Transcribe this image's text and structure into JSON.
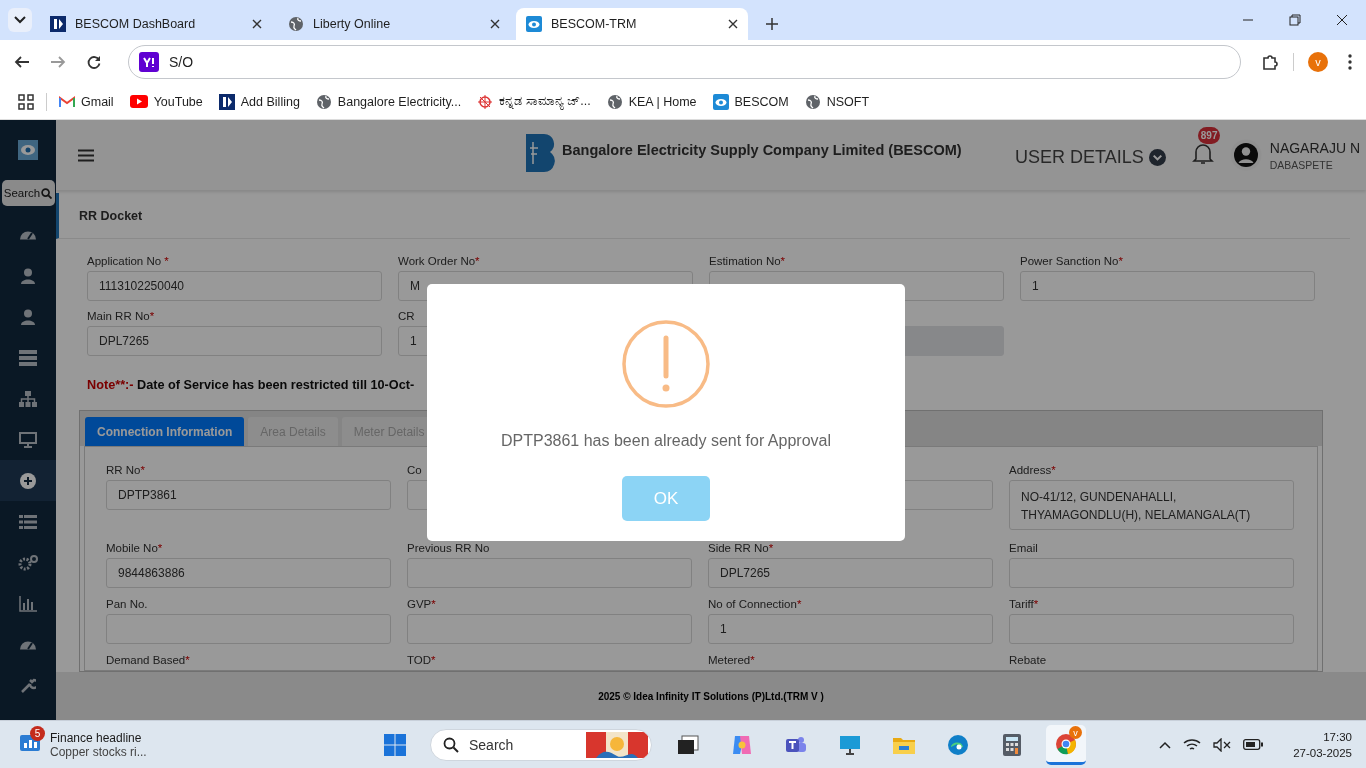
{
  "browser": {
    "tabs": [
      {
        "title": "BESCOM DashBoard",
        "kind": "bescom",
        "selected": false
      },
      {
        "title": "Liberty Online",
        "kind": "globe",
        "selected": false
      },
      {
        "title": "BESCOM-TRM",
        "kind": "trm",
        "selected": true
      }
    ],
    "address": "S/O",
    "profile": "v",
    "bookmarks": [
      {
        "label": "Gmail",
        "kind": "gmail"
      },
      {
        "label": "YouTube",
        "kind": "youtube"
      },
      {
        "label": "Add Billing",
        "kind": "bescom"
      },
      {
        "label": "Bangalore Electricity...",
        "kind": "globe"
      },
      {
        "label": "ಕನ್ನಡ ಸಾಮಾನ್ಯ ಜ್...",
        "kind": "emblem"
      },
      {
        "label": "KEA | Home",
        "kind": "globe"
      },
      {
        "label": "BESCOM",
        "kind": "trm"
      },
      {
        "label": "NSOFT",
        "kind": "globe"
      }
    ]
  },
  "sidebar": {
    "search": "Search",
    "items": [
      {
        "kind": "gauge",
        "selected": false
      },
      {
        "kind": "user",
        "selected": false
      },
      {
        "kind": "user",
        "selected": false
      },
      {
        "kind": "server",
        "selected": false
      },
      {
        "kind": "sitemap",
        "selected": false
      },
      {
        "kind": "desktop",
        "selected": false
      },
      {
        "kind": "plus",
        "selected": true
      },
      {
        "kind": "list",
        "selected": false
      },
      {
        "kind": "cogs",
        "selected": false
      },
      {
        "kind": "chart",
        "selected": false
      },
      {
        "kind": "gauge",
        "selected": false
      },
      {
        "kind": "wrench",
        "selected": false
      }
    ]
  },
  "header": {
    "company": "Bangalore Electricity Supply Company Limited (BESCOM)",
    "user_details": "USER DETAILS",
    "notifications": "897",
    "user_name": "NAGARAJU N",
    "user_location": "DABASPETE"
  },
  "page_title": "RR Docket",
  "top_fields": [
    {
      "label": "Application No ",
      "mark": "*",
      "value": "1113102250040",
      "disabled": false
    },
    {
      "label": "Work Order No",
      "mark": "*",
      "value": "M",
      "disabled": false
    },
    {
      "label": "Estimation No",
      "mark": "*",
      "disabled": false
    },
    {
      "label": "Power Sanction No",
      "mark": "*",
      "value": "1",
      "disabled": false
    },
    {
      "label": "Main RR No",
      "mark": "*",
      "value": "DPL7265",
      "disabled": false
    },
    {
      "label": "CR",
      "value": "1",
      "disabled": false
    },
    {
      "disabled": true
    }
  ],
  "note": {
    "label": "Note**:-",
    "text": "Date of Service has been restricted till 10-Oct-"
  },
  "tabs": [
    {
      "label": "Connection Information",
      "selected": true
    },
    {
      "label": "Area Details",
      "selected": false
    },
    {
      "label": "Meter Details",
      "selected": false
    }
  ],
  "connection_fields": [
    {
      "label": "RR No",
      "mark": "*",
      "value": "DPTP3861",
      "kind": "input"
    },
    {
      "label": "Co",
      "kind": "input"
    },
    {
      "kind": "input"
    },
    {
      "label": "Address",
      "mark": "*",
      "value": "NO-41/12, GUNDENAHALLI, THYAMAGONDLU(H), NELAMANGALA(T)",
      "kind": "textarea"
    },
    {
      "label": "Mobile No",
      "mark": "*",
      "value": "9844863886",
      "kind": "input"
    },
    {
      "label": "Previous RR No",
      "kind": "input"
    },
    {
      "label": "Side RR No",
      "mark": "*",
      "value": "DPL7265",
      "kind": "input"
    },
    {
      "label": "Email",
      "kind": "input"
    },
    {
      "label": "Pan No.",
      "kind": "input"
    },
    {
      "label": "GVP",
      "mark": "*",
      "kind": "input"
    },
    {
      "label": "No of Connection",
      "mark": "*",
      "value": "1",
      "kind": "input"
    },
    {
      "label": "Tariff",
      "mark": "*",
      "kind": "input"
    },
    {
      "label": "Demand Based",
      "mark": "*",
      "kind": "label"
    },
    {
      "label": "TOD",
      "mark": "*",
      "kind": "label"
    },
    {
      "label": "Metered",
      "mark": "*",
      "kind": "label"
    },
    {
      "label": "Rebate",
      "kind": "label"
    }
  ],
  "footer": "2025 © Idea Infinity IT Solutions (P)Ltd.(TRM V )",
  "modal": {
    "message": "DPTP3861 has been already sent for Approval",
    "button": "OK"
  },
  "taskbar": {
    "widget_badge": "5",
    "widget_title": "Finance headline",
    "widget_text": "Copper stocks ri...",
    "search": "Search",
    "apps": [
      {
        "kind": "taskview",
        "selected": false
      },
      {
        "kind": "copilot",
        "selected": false
      },
      {
        "kind": "teams",
        "selected": false
      },
      {
        "kind": "monitor",
        "selected": false
      },
      {
        "kind": "folder",
        "selected": false
      },
      {
        "kind": "edge",
        "selected": false
      },
      {
        "kind": "calculator",
        "selected": false
      },
      {
        "kind": "chrome",
        "selected": true
      }
    ],
    "chrome_badge": "v",
    "time": "17:30",
    "date": "27-03-2025"
  }
}
